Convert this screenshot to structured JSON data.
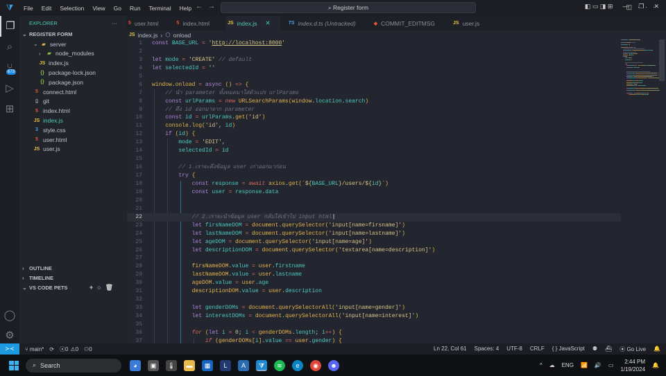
{
  "titlebar": {
    "menu": [
      "File",
      "Edit",
      "Selection",
      "View",
      "Go",
      "Run",
      "Terminal",
      "Help"
    ],
    "command_center": "Register form"
  },
  "activity": {
    "scm_badge": "673"
  },
  "sidebar": {
    "title": "EXPLORER",
    "folder": "REGISTER FORM",
    "items": [
      {
        "label": "server",
        "type": "folder",
        "depth": 1,
        "chev": "v"
      },
      {
        "label": "node_modules",
        "type": "nm",
        "depth": 2,
        "chev": ">"
      },
      {
        "label": "index.js",
        "type": "js",
        "depth": 2
      },
      {
        "label": "package-lock.json",
        "type": "json",
        "depth": 2
      },
      {
        "label": "package.json",
        "type": "json",
        "depth": 2
      },
      {
        "label": "connect.html",
        "type": "html",
        "depth": 1
      },
      {
        "label": "git",
        "type": "git",
        "depth": 1
      },
      {
        "label": "index.html",
        "type": "html",
        "depth": 1
      },
      {
        "label": "index.js",
        "type": "js",
        "depth": 1,
        "selected": true
      },
      {
        "label": "style.css",
        "type": "css",
        "depth": 1
      },
      {
        "label": "user.html",
        "type": "html",
        "depth": 1
      },
      {
        "label": "user.js",
        "type": "js",
        "depth": 1
      }
    ],
    "sections": [
      "OUTLINE",
      "TIMELINE",
      "VS CODE PETS"
    ]
  },
  "tabs": [
    {
      "label": "user.html",
      "type": "html"
    },
    {
      "label": "index.html",
      "type": "html"
    },
    {
      "label": "index.js",
      "type": "js",
      "active": true
    },
    {
      "label": "index.d.ts (Untracked)",
      "type": "ts",
      "italic": true
    },
    {
      "label": "COMMIT_EDITMSG",
      "type": "git"
    },
    {
      "label": "user.js",
      "type": "js"
    }
  ],
  "breadcrumb": [
    "index.js",
    "onload"
  ],
  "code": {
    "current_line": 22,
    "lines": [
      [
        [
          "kw",
          "const "
        ],
        [
          "var",
          "BASE_URL "
        ],
        [
          "op",
          "= "
        ],
        [
          "str",
          "'"
        ],
        [
          "url",
          "http://localhost:8000"
        ],
        [
          "str",
          "'"
        ]
      ],
      [],
      [
        [
          "kw",
          "let "
        ],
        [
          "var",
          "mode "
        ],
        [
          "op",
          "= "
        ],
        [
          "str",
          "'CREATE' "
        ],
        [
          "cm",
          "// default"
        ]
      ],
      [
        [
          "kw",
          "let "
        ],
        [
          "var",
          "selectedId "
        ],
        [
          "op",
          "= "
        ],
        [
          "str",
          "''"
        ]
      ],
      [],
      [
        [
          "fn",
          "window"
        ],
        [
          "pl",
          "."
        ],
        [
          "fn",
          "onload "
        ],
        [
          "op",
          "= "
        ],
        [
          "kw",
          "async "
        ],
        [
          "pn",
          "() "
        ],
        [
          "op",
          "=> "
        ],
        [
          "pn",
          "{"
        ]
      ],
      [
        [
          "pl",
          "    "
        ],
        [
          "cm",
          "// นำ parameter ทั้งหมดมาใส่ตัวแปร urlParams"
        ]
      ],
      [
        [
          "pl",
          "    "
        ],
        [
          "kw",
          "const "
        ],
        [
          "var",
          "urlParams "
        ],
        [
          "op",
          "= "
        ],
        [
          "kwi",
          "new "
        ],
        [
          "fn",
          "URLSearchParams"
        ],
        [
          "pn",
          "("
        ],
        [
          "fn",
          "window"
        ],
        [
          "pl",
          "."
        ],
        [
          "var",
          "location"
        ],
        [
          "pl",
          "."
        ],
        [
          "var",
          "search"
        ],
        [
          "pn",
          ")"
        ]
      ],
      [
        [
          "pl",
          "    "
        ],
        [
          "cm",
          "// ดึง id ออกมาจาก parameter"
        ]
      ],
      [
        [
          "pl",
          "    "
        ],
        [
          "kw",
          "const "
        ],
        [
          "var",
          "id "
        ],
        [
          "op",
          "= "
        ],
        [
          "var",
          "urlParams"
        ],
        [
          "pl",
          "."
        ],
        [
          "fn",
          "get"
        ],
        [
          "pn",
          "("
        ],
        [
          "str",
          "'id'"
        ],
        [
          "pn",
          ")"
        ]
      ],
      [
        [
          "pl",
          "    "
        ],
        [
          "fn",
          "console"
        ],
        [
          "pl",
          "."
        ],
        [
          "fn",
          "log"
        ],
        [
          "pn",
          "("
        ],
        [
          "str",
          "'id'"
        ],
        [
          "pl",
          ", "
        ],
        [
          "var",
          "id"
        ],
        [
          "pn",
          ")"
        ]
      ],
      [
        [
          "pl",
          "    "
        ],
        [
          "kw",
          "if "
        ],
        [
          "pn",
          "("
        ],
        [
          "var",
          "id"
        ],
        [
          "pn",
          ") {"
        ]
      ],
      [
        [
          "pl",
          "        "
        ],
        [
          "var",
          "mode "
        ],
        [
          "op",
          "= "
        ],
        [
          "str",
          "'EDIT'"
        ],
        [
          "pl",
          ","
        ]
      ],
      [
        [
          "pl",
          "        "
        ],
        [
          "var",
          "selectedId "
        ],
        [
          "op",
          "= "
        ],
        [
          "var",
          "id"
        ]
      ],
      [],
      [
        [
          "pl",
          "        "
        ],
        [
          "cm",
          "// 1.เราจะดึงข้อมูล user เก่าออกมาก่อน"
        ]
      ],
      [
        [
          "pl",
          "        "
        ],
        [
          "kw",
          "try "
        ],
        [
          "pn",
          "{"
        ]
      ],
      [
        [
          "pl",
          "            "
        ],
        [
          "kw",
          "const "
        ],
        [
          "var",
          "response "
        ],
        [
          "op",
          "= "
        ],
        [
          "kwi",
          "await "
        ],
        [
          "fn",
          "axios"
        ],
        [
          "pl",
          "."
        ],
        [
          "fn",
          "get"
        ],
        [
          "pn",
          "("
        ],
        [
          "str",
          "`${"
        ],
        [
          "var",
          "BASE_URL"
        ],
        [
          "str",
          "}/users/${"
        ],
        [
          "var",
          "id"
        ],
        [
          "str",
          "}`"
        ],
        [
          "pn",
          ")"
        ]
      ],
      [
        [
          "pl",
          "            "
        ],
        [
          "kw",
          "const "
        ],
        [
          "var",
          "user "
        ],
        [
          "op",
          "= "
        ],
        [
          "var",
          "response"
        ],
        [
          "pl",
          "."
        ],
        [
          "var",
          "data"
        ]
      ],
      [],
      [],
      [
        [
          "pl",
          "            "
        ],
        [
          "cm",
          "// 2.เราจะนำข้อมูล user กลับใส่เข้าไป input html"
        ]
      ],
      [
        [
          "pl",
          "            "
        ],
        [
          "kw",
          "let "
        ],
        [
          "var",
          "firsNameDOM "
        ],
        [
          "op",
          "= "
        ],
        [
          "fn",
          "document"
        ],
        [
          "pl",
          "."
        ],
        [
          "fn",
          "querySelector"
        ],
        [
          "pn",
          "("
        ],
        [
          "str",
          "'input[name=firsname]'"
        ],
        [
          "pn",
          ")"
        ]
      ],
      [
        [
          "pl",
          "            "
        ],
        [
          "kw",
          "let "
        ],
        [
          "var",
          "lastNameDOM "
        ],
        [
          "op",
          "= "
        ],
        [
          "fn",
          "document"
        ],
        [
          "pl",
          "."
        ],
        [
          "fn",
          "querySelector"
        ],
        [
          "pn",
          "("
        ],
        [
          "str",
          "'input[name=lastname]'"
        ],
        [
          "pn",
          ")"
        ]
      ],
      [
        [
          "pl",
          "            "
        ],
        [
          "kw",
          "let "
        ],
        [
          "var",
          "ageDOM "
        ],
        [
          "op",
          "= "
        ],
        [
          "fn",
          "document"
        ],
        [
          "pl",
          "."
        ],
        [
          "fn",
          "querySelector"
        ],
        [
          "pn",
          "("
        ],
        [
          "str",
          "'input[name=age]'"
        ],
        [
          "pn",
          ")"
        ]
      ],
      [
        [
          "pl",
          "            "
        ],
        [
          "kw",
          "let "
        ],
        [
          "var",
          "descriptionDOM "
        ],
        [
          "op",
          "= "
        ],
        [
          "fn",
          "document"
        ],
        [
          "pl",
          "."
        ],
        [
          "fn",
          "querySelector"
        ],
        [
          "pn",
          "("
        ],
        [
          "str",
          "'textarea[name=description]'"
        ],
        [
          "pn",
          ")"
        ]
      ],
      [],
      [
        [
          "pl",
          "            "
        ],
        [
          "fn",
          "firsNameDOM"
        ],
        [
          "pl",
          "."
        ],
        [
          "var",
          "value "
        ],
        [
          "op",
          "= "
        ],
        [
          "fn",
          "user"
        ],
        [
          "pl",
          "."
        ],
        [
          "var",
          "firstname"
        ]
      ],
      [
        [
          "pl",
          "            "
        ],
        [
          "fn",
          "lastNameDOM"
        ],
        [
          "pl",
          "."
        ],
        [
          "var",
          "value "
        ],
        [
          "op",
          "= "
        ],
        [
          "fn",
          "user"
        ],
        [
          "pl",
          "."
        ],
        [
          "var",
          "lastname"
        ]
      ],
      [
        [
          "pl",
          "            "
        ],
        [
          "fn",
          "ageDOM"
        ],
        [
          "pl",
          "."
        ],
        [
          "var",
          "value "
        ],
        [
          "op",
          "= "
        ],
        [
          "fn",
          "user"
        ],
        [
          "pl",
          "."
        ],
        [
          "var",
          "age"
        ]
      ],
      [
        [
          "pl",
          "            "
        ],
        [
          "fn",
          "descriptionDOM"
        ],
        [
          "pl",
          "."
        ],
        [
          "var",
          "value "
        ],
        [
          "op",
          "= "
        ],
        [
          "fn",
          "user"
        ],
        [
          "pl",
          "."
        ],
        [
          "var",
          "description"
        ]
      ],
      [],
      [
        [
          "pl",
          "            "
        ],
        [
          "kw",
          "let "
        ],
        [
          "var",
          "genderDOMs "
        ],
        [
          "op",
          "= "
        ],
        [
          "fn",
          "document"
        ],
        [
          "pl",
          "."
        ],
        [
          "fn",
          "querySelectorAll"
        ],
        [
          "pn",
          "("
        ],
        [
          "str",
          "'input[name=gender]'"
        ],
        [
          "pn",
          ")"
        ]
      ],
      [
        [
          "pl",
          "            "
        ],
        [
          "kw",
          "let "
        ],
        [
          "var",
          "interestDOMs "
        ],
        [
          "op",
          "= "
        ],
        [
          "fn",
          "document"
        ],
        [
          "pl",
          "."
        ],
        [
          "fn",
          "querySelectorAll"
        ],
        [
          "pn",
          "("
        ],
        [
          "str",
          "'input[name=interest]'"
        ],
        [
          "pn",
          ")"
        ]
      ],
      [],
      [
        [
          "pl",
          "            "
        ],
        [
          "kwi",
          "for "
        ],
        [
          "pn",
          "("
        ],
        [
          "kw",
          "let "
        ],
        [
          "var",
          "i "
        ],
        [
          "op",
          "= "
        ],
        [
          "str",
          "0"
        ],
        [
          "pl",
          "; "
        ],
        [
          "var",
          "i "
        ],
        [
          "op",
          "< "
        ],
        [
          "fn",
          "genderDOMs"
        ],
        [
          "pl",
          "."
        ],
        [
          "var",
          "length"
        ],
        [
          "pl",
          "; "
        ],
        [
          "var",
          "i"
        ],
        [
          "op",
          "++"
        ],
        [
          "pn",
          ") {"
        ]
      ],
      [
        [
          "pl",
          "                "
        ],
        [
          "kwi",
          "if "
        ],
        [
          "pn",
          "("
        ],
        [
          "fn",
          "genderDOMs"
        ],
        [
          "pn",
          "["
        ],
        [
          "var",
          "i"
        ],
        [
          "pn",
          "]"
        ],
        [
          "pl",
          "."
        ],
        [
          "var",
          "value "
        ],
        [
          "op",
          "== "
        ],
        [
          "fn",
          "user"
        ],
        [
          "pl",
          "."
        ],
        [
          "var",
          "gender"
        ],
        [
          "pn",
          ") {"
        ]
      ]
    ]
  },
  "status": {
    "branch": "main*",
    "errors": "0",
    "warnings": "0",
    "ports": "0",
    "position": "Ln 22, Col 61",
    "spaces": "Spaces: 4",
    "encoding": "UTF-8",
    "eol": "CRLF",
    "language": "{ } JavaScript",
    "golive": "Go Live"
  },
  "taskbar": {
    "search": "Search",
    "language": "ENG",
    "time": "2:44 PM",
    "date": "1/19/2024"
  }
}
